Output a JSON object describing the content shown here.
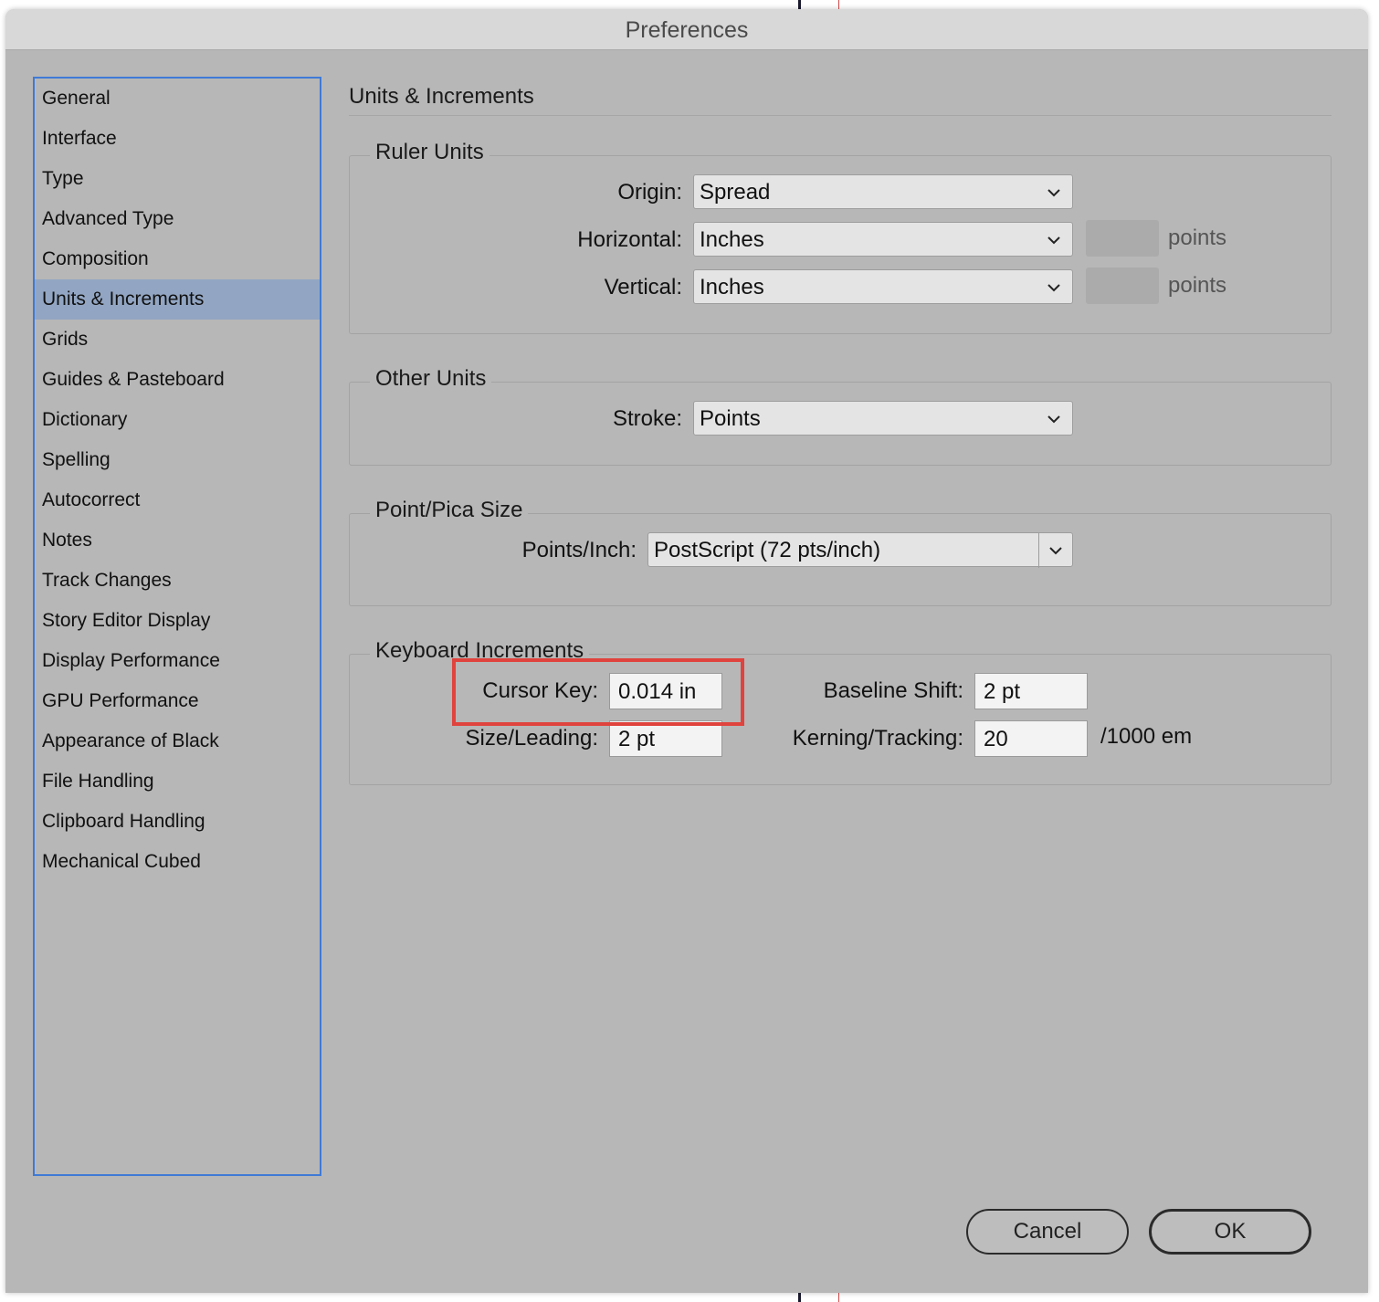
{
  "window": {
    "title": "Preferences"
  },
  "sidebar": {
    "items": [
      {
        "label": "General"
      },
      {
        "label": "Interface"
      },
      {
        "label": "Type"
      },
      {
        "label": "Advanced Type"
      },
      {
        "label": "Composition"
      },
      {
        "label": "Units & Increments",
        "selected": true
      },
      {
        "label": "Grids"
      },
      {
        "label": "Guides & Pasteboard"
      },
      {
        "label": "Dictionary"
      },
      {
        "label": "Spelling"
      },
      {
        "label": "Autocorrect"
      },
      {
        "label": "Notes"
      },
      {
        "label": "Track Changes"
      },
      {
        "label": "Story Editor Display"
      },
      {
        "label": "Display Performance"
      },
      {
        "label": "GPU Performance"
      },
      {
        "label": "Appearance of Black"
      },
      {
        "label": "File Handling"
      },
      {
        "label": "Clipboard Handling"
      },
      {
        "label": "Mechanical Cubed"
      }
    ]
  },
  "main": {
    "title": "Units & Increments",
    "ruler_units": {
      "label": "Ruler Units",
      "origin": {
        "label": "Origin:",
        "value": "Spread"
      },
      "horizontal": {
        "label": "Horizontal:",
        "value": "Inches",
        "unit": "points"
      },
      "vertical": {
        "label": "Vertical:",
        "value": "Inches",
        "unit": "points"
      }
    },
    "other_units": {
      "label": "Other Units",
      "stroke": {
        "label": "Stroke:",
        "value": "Points"
      }
    },
    "point_pica": {
      "label": "Point/Pica Size",
      "points_inch": {
        "label": "Points/Inch:",
        "value": "PostScript (72 pts/inch)"
      }
    },
    "keyboard": {
      "label": "Keyboard Increments",
      "cursor_key": {
        "label": "Cursor Key:",
        "value": "0.014 in"
      },
      "size_leading": {
        "label": "Size/Leading:",
        "value": "2 pt"
      },
      "baseline_shift": {
        "label": "Baseline Shift:",
        "value": "2 pt"
      },
      "kerning_tracking": {
        "label": "Kerning/Tracking:",
        "value": "20",
        "unit": "/1000 em"
      }
    }
  },
  "buttons": {
    "cancel": "Cancel",
    "ok": "OK"
  },
  "colors": {
    "selection": "#92a6c3",
    "sidebar_border": "#3f7ad6",
    "highlight": "#e0433d"
  }
}
